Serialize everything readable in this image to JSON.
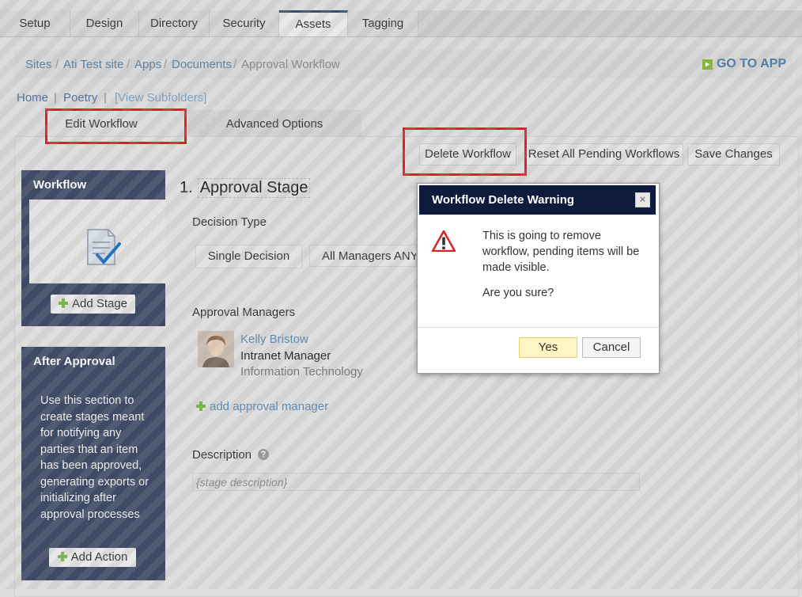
{
  "top_tabs": [
    "Setup",
    "Design",
    "Directory",
    "Security",
    "Assets",
    "Tagging"
  ],
  "breadcrumb": {
    "items": [
      "Sites",
      "Ati Test site",
      "Apps",
      "Documents"
    ],
    "current": "Approval Workflow",
    "separator": "/",
    "go_to_app": "GO TO APP"
  },
  "subnav": {
    "home": "Home",
    "poetry": "Poetry",
    "view_subfolders": "[View Subfolders]",
    "divider": "|"
  },
  "panel_tabs": [
    "Edit Workflow",
    "Advanced Options"
  ],
  "actions": {
    "delete": "Delete Workflow",
    "reset": "Reset All Pending Workflows",
    "save": "Save Changes"
  },
  "sidebar": {
    "workflow_title": "Workflow",
    "add_stage": "Add Stage",
    "after_title": "After Approval",
    "after_text": "Use this section to create stages meant for notifying any parties that an item has been approved, generating exports or initializing after approval processes",
    "add_action": "Add Action"
  },
  "stage": {
    "number": "1.",
    "title": "Approval Stage",
    "decision_label": "Decision Type",
    "decision_options": [
      "Single Decision",
      "All Managers ANY"
    ],
    "managers_label": "Approval Managers",
    "manager": {
      "name": "Kelly Bristow",
      "title": "Intranet Manager",
      "dept": "Information Technology"
    },
    "add_manager": "add approval manager",
    "description_label": "Description",
    "description_placeholder": "{stage description}"
  },
  "dialog": {
    "title": "Workflow Delete Warning",
    "message": "This is going to remove workflow, pending items will be made visible.",
    "question": "Are you sure?",
    "yes": "Yes",
    "cancel": "Cancel",
    "close": "×"
  },
  "colors": {
    "nav_dark": "#3f4a66",
    "dialog_header": "#0f1b3d",
    "highlight": "#e02020",
    "link": "#5a7fa3"
  }
}
